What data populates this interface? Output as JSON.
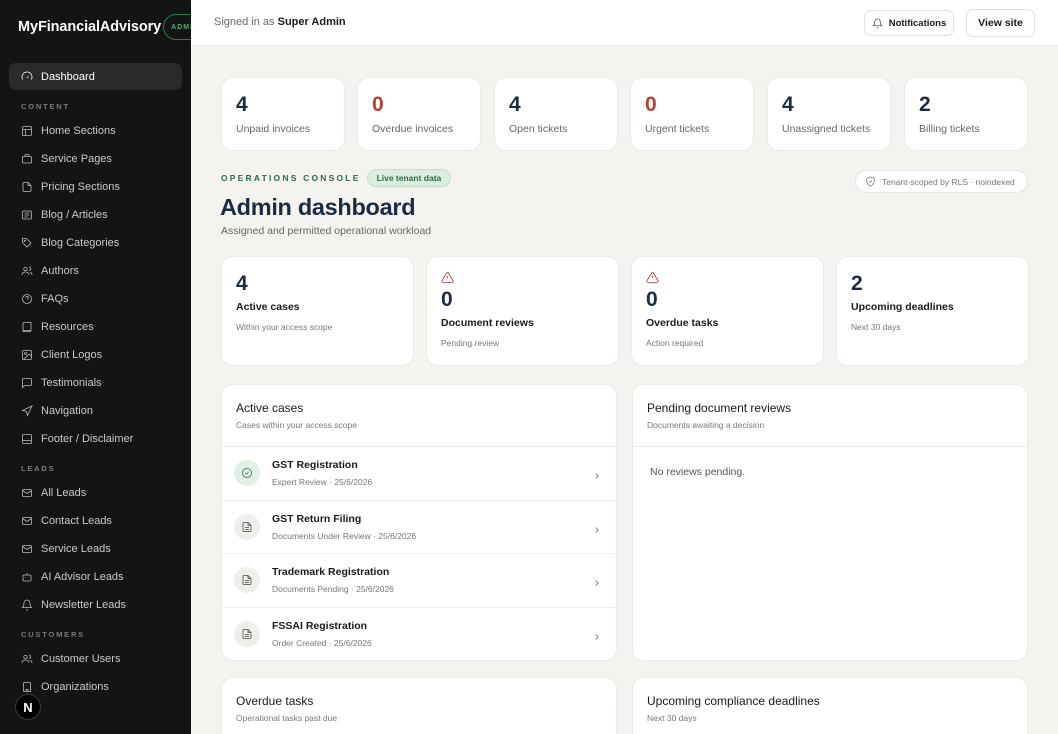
{
  "brand": {
    "name": "MyFinancialAdvisory",
    "badge": "ADMIN"
  },
  "sidebar": {
    "top": [
      {
        "label": "Dashboard",
        "icon": "gauge-icon",
        "active": true
      }
    ],
    "sections": [
      {
        "label": "CONTENT",
        "items": [
          {
            "label": "Home Sections",
            "icon": "layout-icon"
          },
          {
            "label": "Service Pages",
            "icon": "briefcase-icon"
          },
          {
            "label": "Pricing Sections",
            "icon": "file-icon"
          },
          {
            "label": "Blog / Articles",
            "icon": "newspaper-icon"
          },
          {
            "label": "Blog Categories",
            "icon": "tag-icon"
          },
          {
            "label": "Authors",
            "icon": "users-icon"
          },
          {
            "label": "FAQs",
            "icon": "help-circle-icon"
          },
          {
            "label": "Resources",
            "icon": "book-icon"
          },
          {
            "label": "Client Logos",
            "icon": "image-icon"
          },
          {
            "label": "Testimonials",
            "icon": "message-icon"
          },
          {
            "label": "Navigation",
            "icon": "navigation-icon"
          },
          {
            "label": "Footer / Disclaimer",
            "icon": "panel-bottom-icon"
          }
        ]
      },
      {
        "label": "LEADS",
        "items": [
          {
            "label": "All Leads",
            "icon": "mail-icon"
          },
          {
            "label": "Contact Leads",
            "icon": "mail-icon"
          },
          {
            "label": "Service Leads",
            "icon": "mail-icon"
          },
          {
            "label": "AI Advisor Leads",
            "icon": "bot-icon"
          },
          {
            "label": "Newsletter Leads",
            "icon": "bell-icon"
          }
        ]
      },
      {
        "label": "CUSTOMERS",
        "items": [
          {
            "label": "Customer Users",
            "icon": "users-icon"
          },
          {
            "label": "Organizations",
            "icon": "building-icon"
          }
        ]
      }
    ],
    "floating_badge": "N"
  },
  "topbar": {
    "signed_prefix": "Signed in as",
    "user": "Super Admin",
    "notifications_label": "Notifications",
    "view_site_label": "View site"
  },
  "stats": [
    {
      "value": "4",
      "label": "Unpaid invoices",
      "alert": false
    },
    {
      "value": "0",
      "label": "Overdue invoices",
      "alert": true
    },
    {
      "value": "4",
      "label": "Open tickets",
      "alert": false
    },
    {
      "value": "0",
      "label": "Urgent tickets",
      "alert": true
    },
    {
      "value": "4",
      "label": "Unassigned tickets",
      "alert": false
    },
    {
      "value": "2",
      "label": "Billing tickets",
      "alert": false
    }
  ],
  "ops": {
    "label": "OPERATIONS CONSOLE",
    "live_badge": "Live tenant data",
    "tenant_note": "Tenant-scoped by RLS · noindexed",
    "title": "Admin dashboard",
    "subtitle": "Assigned and permitted operational workload"
  },
  "kpis": [
    {
      "value": "4",
      "title": "Active cases",
      "sub": "Within your access scope",
      "warning": false
    },
    {
      "value": "0",
      "title": "Document reviews",
      "sub": "Pending review",
      "warning": true
    },
    {
      "value": "0",
      "title": "Overdue tasks",
      "sub": "Action required",
      "warning": true
    },
    {
      "value": "2",
      "title": "Upcoming deadlines",
      "sub": "Next 30 days",
      "warning": false
    }
  ],
  "active_cases": {
    "title": "Active cases",
    "subtitle": "Cases within your access scope",
    "rows": [
      {
        "name": "GST Registration",
        "meta": "Expert Review · 25/6/2026",
        "icon": "check-circle-icon"
      },
      {
        "name": "GST Return Filing",
        "meta": "Documents Under Review · 25/6/2026",
        "icon": "document-icon"
      },
      {
        "name": "Trademark Registration",
        "meta": "Documents Pending · 25/6/2026",
        "icon": "document-icon"
      },
      {
        "name": "FSSAI Registration",
        "meta": "Order Created · 25/6/2026",
        "icon": "document-icon"
      }
    ]
  },
  "pending_reviews": {
    "title": "Pending document reviews",
    "subtitle": "Documents awaiting a decision",
    "empty": "No reviews pending."
  },
  "overdue_tasks": {
    "title": "Overdue tasks",
    "subtitle": "Operational tasks past due"
  },
  "deadlines": {
    "title": "Upcoming compliance deadlines",
    "subtitle": "Next 30 days"
  },
  "colors": {
    "sidebar_bg": "#141414",
    "accent_green": "#2f6b45",
    "alert_red": "#b5402e",
    "navy": "#1c2a44"
  }
}
